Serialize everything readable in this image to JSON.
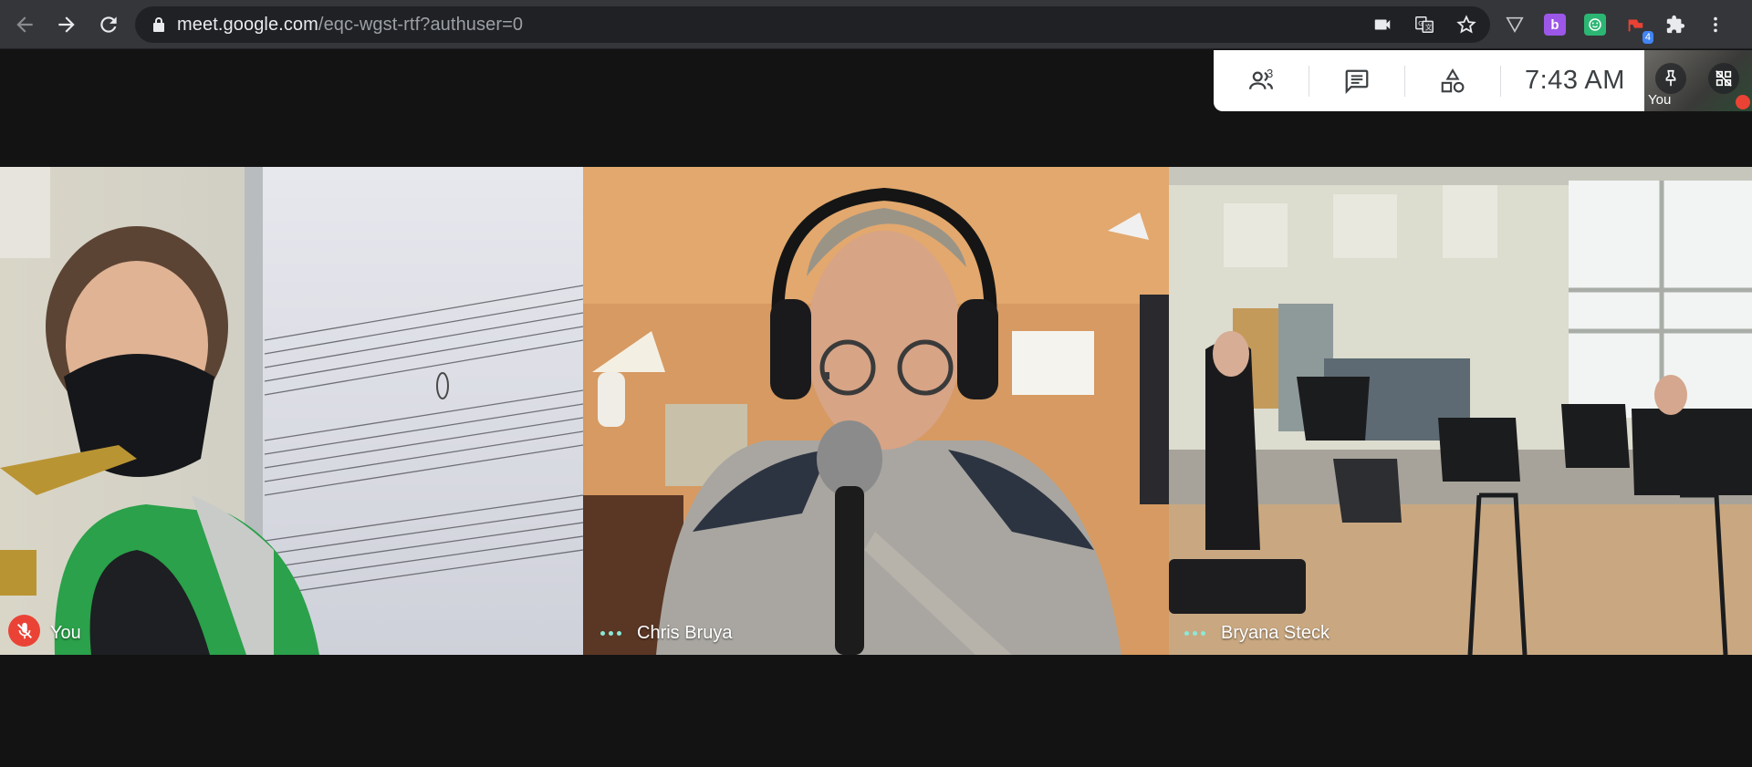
{
  "browser": {
    "url_host": "meet.google.com",
    "url_path": "/eqc-wgst-rtf?authuser=0",
    "extensions": [
      {
        "name": "shield-extension-icon",
        "color": "#35363a",
        "text": ""
      },
      {
        "name": "b-extension-icon",
        "color": "#9c57e8",
        "text": "b"
      },
      {
        "name": "smile-extension-icon",
        "color": "#2bb673",
        "text": ""
      },
      {
        "name": "flag-extension-icon",
        "color": "#e8eaed",
        "text": "",
        "badge": "4"
      }
    ]
  },
  "meet_panel": {
    "people_count": "3",
    "time": "7:43  AM"
  },
  "self_view": {
    "label": "You"
  },
  "participants": [
    {
      "name": "You",
      "muted": true
    },
    {
      "name": "Chris Bruya",
      "muted": false
    },
    {
      "name": "Bryana Steck",
      "muted": false
    }
  ],
  "colors": {
    "background": "#131314",
    "panel": "#ffffff",
    "muted_red": "#ea4335",
    "speaking_dots": "#8ce8d8"
  }
}
